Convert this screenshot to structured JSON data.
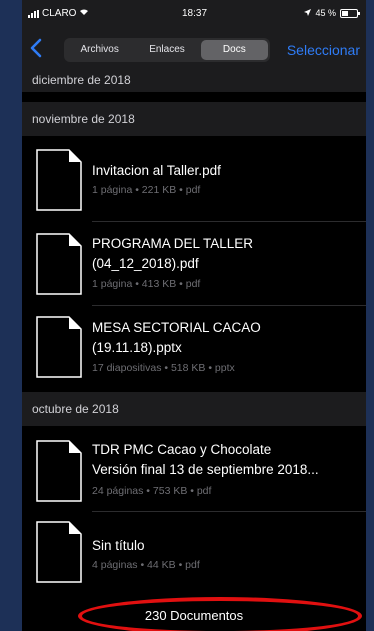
{
  "status_bar": {
    "carrier": "CLARO",
    "time": "18:37",
    "battery": "45 %"
  },
  "nav": {
    "tabs": [
      "Archivos",
      "Enlaces",
      "Docs"
    ],
    "active_tab": "Docs",
    "select_label": "Seleccionar"
  },
  "sections": {
    "dec": "diciembre de 2018",
    "nov": "noviembre de 2018",
    "oct": "octubre de 2018"
  },
  "items": [
    {
      "title": "Invitacion al Taller.pdf",
      "meta": "1 página • 221 KB • pdf"
    },
    {
      "title_line1": "PROGRAMA DEL TALLER",
      "title_line2": "(04_12_2018).pdf",
      "meta": "1 página • 413 KB • pdf"
    },
    {
      "title_line1": "MESA SECTORIAL CACAO",
      "title_line2": "(19.11.18).pptx",
      "meta": "17 diapositivas • 518 KB • pptx"
    },
    {
      "title_line1": "TDR PMC Cacao y Chocolate",
      "title_line2": "Versión final 13 de septiembre 2018...",
      "meta": "24 páginas • 753 KB • pdf"
    },
    {
      "title": "Sin título",
      "meta": "4 páginas • 44 KB • pdf"
    }
  ],
  "footer": {
    "count_label": "230 Documentos"
  },
  "colors": {
    "accent": "#2f7cf6",
    "highlight_oval": "#e11010",
    "page_background": "#1d3057"
  }
}
